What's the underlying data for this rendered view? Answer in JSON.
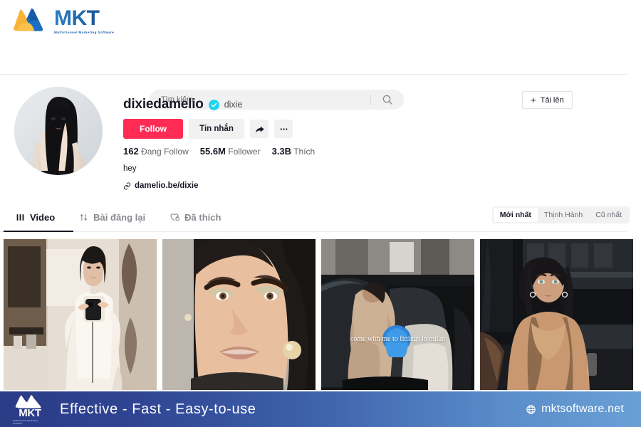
{
  "brand": {
    "name": "MKT",
    "tagline": "Multichannel Marketing Software",
    "logo_icon": "mkt-logo-icon",
    "colors": {
      "orange": "#f6a623",
      "blue": "#1d5fa8",
      "accent_red": "#fe2c55",
      "verified_blue": "#20d5ec"
    }
  },
  "header": {
    "search": {
      "placeholder": "Tìm kiếm",
      "value": "",
      "icon": "search-icon"
    },
    "upload": {
      "label": "Tải lên",
      "icon": "plus-icon"
    }
  },
  "profile": {
    "avatar_alt": "dixiedamelio profile photo",
    "username": "dixiedamelio",
    "verified": true,
    "nickname": "dixie",
    "follow_label": "Follow",
    "message_label": "Tin nhắn",
    "share_icon": "share-arrow-icon",
    "more_icon": "more-dots-icon",
    "stats": [
      {
        "value": "162",
        "label": "Đang Follow"
      },
      {
        "value": "55.6M",
        "label": "Follower"
      },
      {
        "value": "3.3B",
        "label": "Thích"
      }
    ],
    "bio": "hey",
    "link": {
      "icon": "link-icon",
      "text": "damelio.be/dixie"
    }
  },
  "tabs": [
    {
      "label": "Video",
      "icon": "grid-icon",
      "active": true
    },
    {
      "label": "Bài đăng lại",
      "icon": "repost-icon",
      "active": false
    },
    {
      "label": "Đã thích",
      "icon": "heart-lock-icon",
      "active": false
    }
  ],
  "filters": [
    {
      "label": "Mới nhất",
      "active": true
    },
    {
      "label": "Thịnh Hành",
      "active": false
    },
    {
      "label": "Cũ nhất",
      "active": false
    }
  ],
  "videos": [
    {
      "description": "mirror selfie in kitchen wearing white pyjama shirt",
      "overlay": ""
    },
    {
      "description": "close-up face with green eyeshadow and pearl earring",
      "overlay": ""
    },
    {
      "description": "getting out of a car with blue handbag",
      "overlay": "come with me to fittings in milan"
    },
    {
      "description": "outdoors at night in brown tank top",
      "overlay": ""
    }
  ],
  "banner": {
    "logo_name": "MKT",
    "logo_sub": "Multichannel Marketing Software",
    "slogan": "Effective - Fast - Easy-to-use",
    "website": "mktsoftware.net",
    "globe_icon": "globe-icon"
  }
}
